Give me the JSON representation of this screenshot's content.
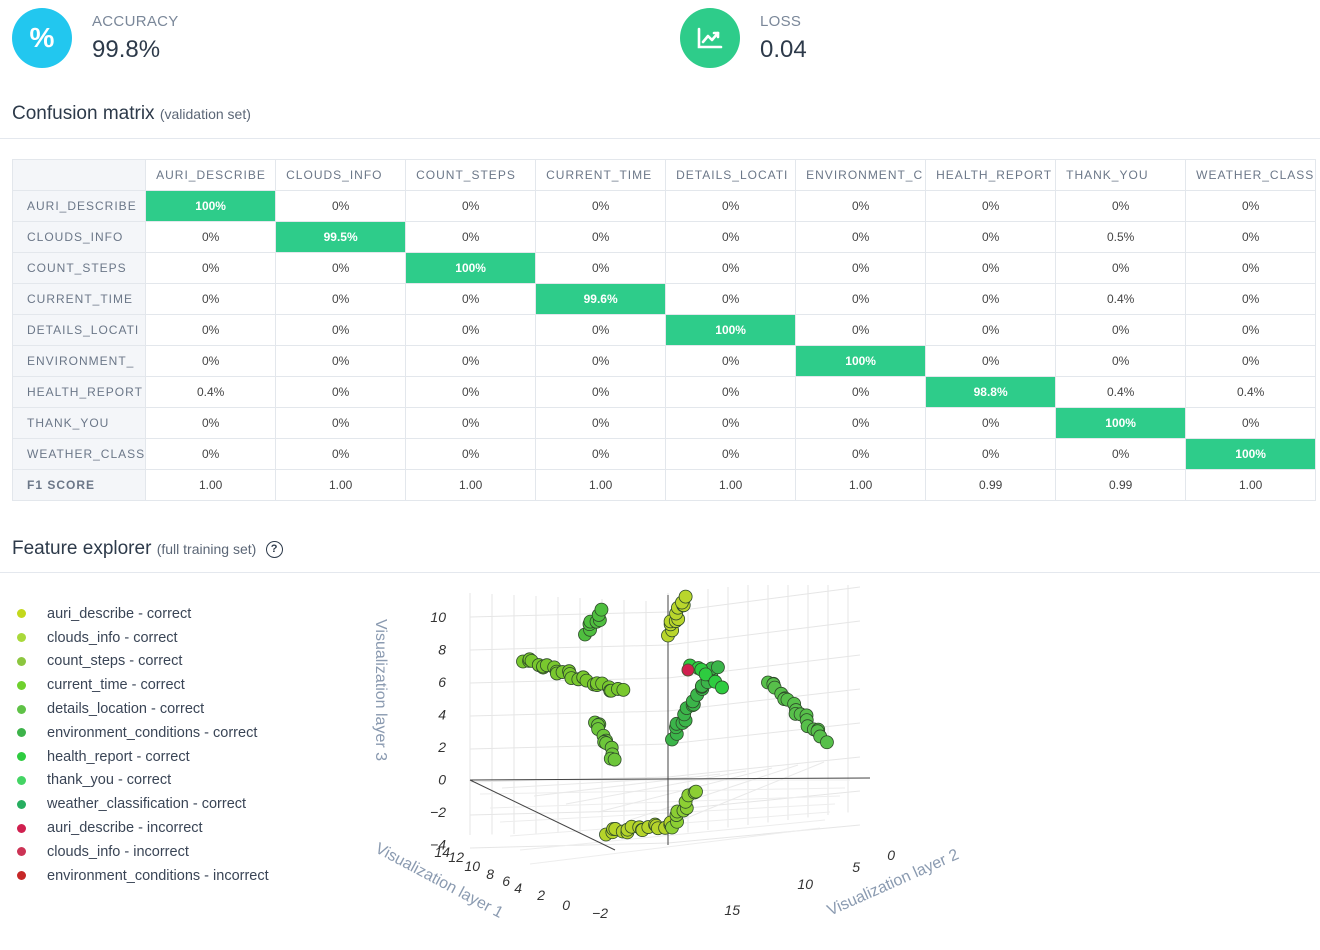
{
  "metrics": {
    "accuracy": {
      "label": "ACCURACY",
      "value": "99.8%",
      "icon": "percent-icon",
      "color": "#22c7ef"
    },
    "loss": {
      "label": "LOSS",
      "value": "0.04",
      "icon": "chart-line-icon",
      "color": "#2ecc8a"
    }
  },
  "confusion": {
    "title": "Confusion matrix",
    "subtitle": "(validation set)",
    "columns": [
      "AURI_DESCRIBE",
      "CLOUDS_INFO",
      "COUNT_STEPS",
      "CURRENT_TIME",
      "DETAILS_LOCATI",
      "ENVIRONMENT_C",
      "HEALTH_REPORT",
      "THANK_YOU",
      "WEATHER_CLASS"
    ],
    "rows": [
      {
        "label": "AURI_DESCRIBE",
        "cells": [
          "100%",
          "0%",
          "0%",
          "0%",
          "0%",
          "0%",
          "0%",
          "0%",
          "0%"
        ]
      },
      {
        "label": "CLOUDS_INFO",
        "cells": [
          "0%",
          "99.5%",
          "0%",
          "0%",
          "0%",
          "0%",
          "0%",
          "0.5%",
          "0%"
        ]
      },
      {
        "label": "COUNT_STEPS",
        "cells": [
          "0%",
          "0%",
          "100%",
          "0%",
          "0%",
          "0%",
          "0%",
          "0%",
          "0%"
        ]
      },
      {
        "label": "CURRENT_TIME",
        "cells": [
          "0%",
          "0%",
          "0%",
          "99.6%",
          "0%",
          "0%",
          "0%",
          "0.4%",
          "0%"
        ]
      },
      {
        "label": "DETAILS_LOCATI",
        "cells": [
          "0%",
          "0%",
          "0%",
          "0%",
          "100%",
          "0%",
          "0%",
          "0%",
          "0%"
        ]
      },
      {
        "label": "ENVIRONMENT_",
        "cells": [
          "0%",
          "0%",
          "0%",
          "0%",
          "0%",
          "100%",
          "0%",
          "0%",
          "0%"
        ]
      },
      {
        "label": "HEALTH_REPORT",
        "cells": [
          "0.4%",
          "0%",
          "0%",
          "0%",
          "0%",
          "0%",
          "98.8%",
          "0.4%",
          "0.4%"
        ]
      },
      {
        "label": "THANK_YOU",
        "cells": [
          "0%",
          "0%",
          "0%",
          "0%",
          "0%",
          "0%",
          "0%",
          "100%",
          "0%"
        ]
      },
      {
        "label": "WEATHER_CLASS",
        "cells": [
          "0%",
          "0%",
          "0%",
          "0%",
          "0%",
          "0%",
          "0%",
          "0%",
          "100%"
        ]
      }
    ],
    "f1": {
      "label": "F1 SCORE",
      "cells": [
        "1.00",
        "1.00",
        "1.00",
        "1.00",
        "1.00",
        "1.00",
        "0.99",
        "0.99",
        "1.00"
      ]
    },
    "diag_color": "#2ecc8a"
  },
  "feature": {
    "title": "Feature explorer",
    "subtitle": "(full training set)",
    "help_icon": "question-circle-icon",
    "legend": [
      {
        "name": "auri_describe - correct",
        "color": "#c3d81d"
      },
      {
        "name": "clouds_info - correct",
        "color": "#a9d93a"
      },
      {
        "name": "count_steps - correct",
        "color": "#8cc63f"
      },
      {
        "name": "current_time - correct",
        "color": "#6fd12e"
      },
      {
        "name": "details_location - correct",
        "color": "#5fc247"
      },
      {
        "name": "environment_conditions - correct",
        "color": "#3db34a"
      },
      {
        "name": "health_report - correct",
        "color": "#2ecc40"
      },
      {
        "name": "thank_you - correct",
        "color": "#44d464"
      },
      {
        "name": "weather_classification - correct",
        "color": "#27ae60"
      },
      {
        "name": "auri_describe - incorrect",
        "color": "#d0204f"
      },
      {
        "name": "clouds_info - incorrect",
        "color": "#cc3355"
      },
      {
        "name": "environment_conditions - incorrect",
        "color": "#c62828"
      }
    ],
    "axes": {
      "z_label": "Visualization layer 3",
      "x_label": "Visualization layer 1",
      "y_label": "Visualization layer 2",
      "z_ticks": [
        "10",
        "8",
        "6",
        "4",
        "2",
        "0",
        "−2",
        "−4"
      ],
      "x_ticks": [
        "14",
        "12",
        "10",
        "8",
        "6",
        "4",
        "2",
        "0",
        "−2"
      ],
      "y_ticks": [
        "0",
        "5",
        "10",
        "15"
      ]
    }
  }
}
